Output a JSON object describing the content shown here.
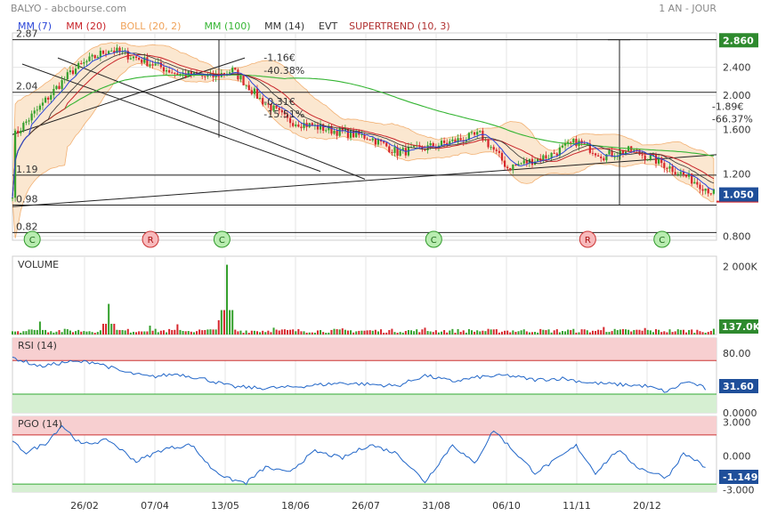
{
  "header": {
    "title": "BALYO - abcbourse.com",
    "period": "1 AN - JOUR"
  },
  "colors": {
    "up": "#34a02c",
    "down": "#d6262c",
    "mm7": "#2a45d8",
    "mm20": "#c8242a",
    "boll": "#f0a35a",
    "mm100": "#35b533",
    "mm14": "#333333",
    "supertrend": "#b03030",
    "grid": "#e4e4e4",
    "rsi_upper": "#f7cfd0",
    "rsi_lower": "#d6efd2",
    "indicator": "#2166c8"
  },
  "legend": [
    {
      "label": "MM (7)",
      "color": "#2a45d8"
    },
    {
      "label": "MM (20)",
      "color": "#c8242a"
    },
    {
      "label": "BOLL (20, 2)",
      "color": "#f0a35a"
    },
    {
      "label": "MM (100)",
      "color": "#35b533"
    },
    {
      "label": "MM (14)",
      "color": "#333333"
    },
    {
      "label": "EVT",
      "color": "#333333"
    },
    {
      "label": "SUPERTREND (10, 3)",
      "color": "#b03030"
    }
  ],
  "x_axis": {
    "labels": [
      "26/02",
      "07/04",
      "13/05",
      "18/06",
      "26/07",
      "31/08",
      "06/10",
      "11/11",
      "20/12"
    ]
  },
  "chart_data": [
    {
      "type": "candlestick",
      "y_scale": "log",
      "ylim": [
        0.78,
        3.0
      ],
      "y_ticks": [
        "2.400",
        "2.000",
        "1.600",
        "1.200",
        "0.800"
      ],
      "last_price_label": "1.050",
      "max_label": "2.860",
      "levels": [
        {
          "label": "2.87",
          "value": 2.87
        },
        {
          "label": "2.04",
          "value": 2.04
        },
        {
          "label": "1.19",
          "value": 1.19
        },
        {
          "label": "0.98",
          "value": 0.98
        },
        {
          "label": "0.82",
          "value": 0.82
        }
      ],
      "close_path": [
        [
          1,
          1.55
        ],
        [
          10,
          1.85
        ],
        [
          22,
          2.35
        ],
        [
          35,
          2.7
        ],
        [
          45,
          2.55
        ],
        [
          60,
          2.3
        ],
        [
          72,
          2.25
        ],
        [
          80,
          2.35
        ],
        [
          90,
          1.95
        ],
        [
          100,
          1.7
        ],
        [
          115,
          1.6
        ],
        [
          130,
          1.52
        ],
        [
          140,
          1.38
        ],
        [
          150,
          1.42
        ],
        [
          160,
          1.48
        ],
        [
          170,
          1.55
        ],
        [
          180,
          1.25
        ],
        [
          195,
          1.35
        ],
        [
          205,
          1.48
        ],
        [
          215,
          1.35
        ],
        [
          225,
          1.4
        ],
        [
          235,
          1.3
        ],
        [
          245,
          1.18
        ],
        [
          250,
          1.12
        ],
        [
          255,
          1.06
        ]
      ],
      "annotations": [
        {
          "text": "-1.16€",
          "x": 92,
          "price": 2.5
        },
        {
          "text": "-40.38%",
          "x": 92,
          "price": 2.3
        },
        {
          "text": "-0.31€",
          "x": 92,
          "price": 1.88
        },
        {
          "text": "-15.51%",
          "x": 92,
          "price": 1.73
        },
        {
          "text": "-1.89€",
          "x": 255,
          "price": 1.82
        },
        {
          "text": "-66.37%",
          "x": 255,
          "price": 1.68
        }
      ],
      "signals": [
        {
          "type": "C",
          "x": 2
        },
        {
          "type": "R",
          "x": 45
        },
        {
          "type": "C",
          "x": 71
        },
        {
          "type": "C",
          "x": 148
        },
        {
          "type": "R",
          "x": 204
        },
        {
          "type": "C",
          "x": 231
        }
      ]
    },
    {
      "type": "bar",
      "title": "VOLUME",
      "y_ticks": [
        "2 000K"
      ],
      "last_label": "137.0K",
      "peaks": [
        [
          10,
          380
        ],
        [
          35,
          900
        ],
        [
          50,
          260
        ],
        [
          60,
          300
        ],
        [
          75,
          420
        ],
        [
          78,
          2050
        ],
        [
          95,
          200
        ],
        [
          120,
          180
        ],
        [
          150,
          200
        ],
        [
          175,
          150
        ],
        [
          215,
          220
        ],
        [
          230,
          190
        ]
      ]
    },
    {
      "type": "line",
      "title": "RSI (14)",
      "ylim": [
        0,
        100
      ],
      "y_ticks": [
        "80.00",
        "0.0000"
      ],
      "last_label": "31.60",
      "anchors": [
        [
          0,
          74
        ],
        [
          10,
          62
        ],
        [
          20,
          68
        ],
        [
          30,
          68
        ],
        [
          40,
          55
        ],
        [
          50,
          48
        ],
        [
          60,
          52
        ],
        [
          70,
          45
        ],
        [
          80,
          35
        ],
        [
          90,
          33
        ],
        [
          100,
          34
        ],
        [
          120,
          40
        ],
        [
          140,
          36
        ],
        [
          150,
          50
        ],
        [
          160,
          42
        ],
        [
          170,
          48
        ],
        [
          180,
          50
        ],
        [
          190,
          44
        ],
        [
          200,
          46
        ],
        [
          210,
          40
        ],
        [
          220,
          38
        ],
        [
          230,
          36
        ],
        [
          238,
          28
        ],
        [
          245,
          42
        ],
        [
          250,
          36
        ],
        [
          252,
          32
        ]
      ]
    },
    {
      "type": "line",
      "title": "PGO (14)",
      "ylim": [
        -3.2,
        3.5
      ],
      "y_ticks": [
        "3.000",
        "0.000",
        "-3.000"
      ],
      "last_label": "-1.149",
      "anchors": [
        [
          0,
          1.2
        ],
        [
          5,
          0.3
        ],
        [
          12,
          1.1
        ],
        [
          18,
          2.7
        ],
        [
          25,
          1.0
        ],
        [
          35,
          1.4
        ],
        [
          45,
          -0.5
        ],
        [
          55,
          0.6
        ],
        [
          65,
          1.0
        ],
        [
          72,
          -1.0
        ],
        [
          78,
          -2.0
        ],
        [
          85,
          -2.4
        ],
        [
          92,
          -1.0
        ],
        [
          100,
          -1.5
        ],
        [
          110,
          0.4
        ],
        [
          120,
          -0.2
        ],
        [
          130,
          1.0
        ],
        [
          140,
          0.2
        ],
        [
          150,
          -2.3
        ],
        [
          160,
          1.0
        ],
        [
          168,
          -0.7
        ],
        [
          175,
          2.3
        ],
        [
          182,
          0.5
        ],
        [
          190,
          -1.5
        ],
        [
          198,
          -0.3
        ],
        [
          205,
          0.9
        ],
        [
          212,
          -1.5
        ],
        [
          220,
          0.5
        ],
        [
          228,
          -1.1
        ],
        [
          238,
          -1.9
        ],
        [
          244,
          0.2
        ],
        [
          248,
          -0.3
        ],
        [
          252,
          -1.1
        ]
      ]
    }
  ]
}
